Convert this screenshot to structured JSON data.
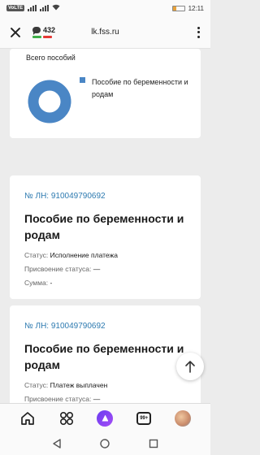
{
  "status_bar": {
    "left_chip": "VoLTE",
    "time": "12:11"
  },
  "browser": {
    "comments_count": "432",
    "url": "lk.fss.ru",
    "comment_bar_colors": [
      "#3fae49",
      "#e53935"
    ]
  },
  "chart": {
    "title": "Всего пособий",
    "legend": [
      {
        "label": "Пособие по беременности и родам",
        "color": "#4a86c5"
      }
    ],
    "chart_data": {
      "type": "pie",
      "donut": true,
      "slices": [
        {
          "label": "Пособие по беременности и родам",
          "share": 1.0,
          "color": "#4a86c5"
        }
      ]
    }
  },
  "benefits": [
    {
      "ln": "№ ЛН: 910049790692",
      "title": "Пособие по беременности и родам",
      "status_label": "Статус:",
      "status_value": "Исполнение платежа",
      "assign_label": "Присвоение статуса:",
      "assign_value": "—",
      "sum_label": "Сумма:",
      "sum_value": "-"
    },
    {
      "ln": "№ ЛН: 910049790692",
      "title": "Пособие по беременности и родам",
      "status_label": "Статус:",
      "status_value": "Платеж выплачен",
      "assign_label": "Присвоение статуса:",
      "assign_value": "—"
    }
  ],
  "bottom_nav": {
    "tabs_count": "99+"
  },
  "icons": {
    "close": "close-icon",
    "menu": "more-vertical-icon",
    "scroll_top": "arrow-up-icon",
    "home": "home-icon",
    "services": "grid-icon",
    "assistant": "alice-icon",
    "tabs": "tabs-icon",
    "profile": "avatar",
    "back": "triangle-back-icon",
    "home_sys": "circle-home-icon",
    "recents": "square-recents-icon"
  },
  "colors": {
    "link": "#2d7ab0",
    "chart_blue": "#4a86c5",
    "page_bg": "#ececec"
  }
}
